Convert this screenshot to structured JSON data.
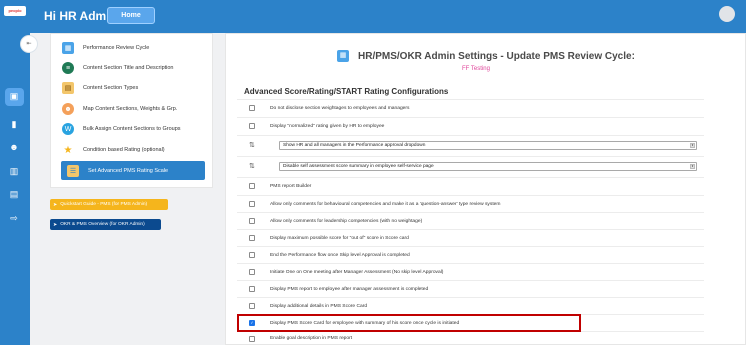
{
  "topbar": {
    "logo_text": "peoplo",
    "greeting": "Hi HR Admin",
    "home_label": "Home"
  },
  "rail": {
    "toggle_glyph": "⇤"
  },
  "menu": {
    "items": [
      {
        "label": "Performance Review Cycle",
        "icon": "calendar-icon"
      },
      {
        "label": "Content Section Title and Description",
        "icon": "section-icon"
      },
      {
        "label": "Content Section Types",
        "icon": "types-icon"
      },
      {
        "label": "Map Content Sections, Weights & Grp.",
        "icon": "map-user-icon"
      },
      {
        "label": "Bulk Assign Content Sections to Groups",
        "icon": "bulk-assign-icon"
      },
      {
        "label": "Condition based Rating (optional)",
        "icon": "star-icon"
      },
      {
        "label": "Set Advanced PMS Rating Scale",
        "icon": "rating-scale-icon"
      }
    ]
  },
  "guides": {
    "quickstart": "Quickstart Guide - PMS (for PMS Admin)",
    "overview": "OKR & PMS Overview (for OKR Admin)"
  },
  "main": {
    "title": "HR/PMS/OKR Admin Settings - Update PMS Review Cycle:",
    "subtitle": "FF Testing",
    "section_title": "Advanced Score/Rating/START Rating Configurations",
    "options": [
      {
        "label": "Do not disclose section weightages to employees and managers",
        "checked": false
      },
      {
        "label": "Display \"normalized\" rating given by HR to employee",
        "checked": false
      },
      {
        "select": "Show HR and all managers in the Performance approval dropdown"
      },
      {
        "select": "Disable self assessment score summary in employee self-service page"
      },
      {
        "label": "PMS report Builder",
        "checked": false
      },
      {
        "label": "Allow only comments for behavioural competencies and make it as a 'question-answer' type review system",
        "checked": false
      },
      {
        "label": "Allow only comments for leadership competencies (with no weightage)",
        "checked": false
      },
      {
        "label": "Display maximum possible score for \"out of\" score in Score card",
        "checked": false
      },
      {
        "label": "End the Performance flow once Skip level Approval is completed",
        "checked": false
      },
      {
        "label": "Initiate One on One meeting after Manager Assessment (No skip level Approval)",
        "checked": false
      },
      {
        "label": "Display PMS report to employee after manager assessment is completed",
        "checked": false
      },
      {
        "label": "Display additional details in PMS Score Card",
        "checked": false
      },
      {
        "label": "Display PMS Score Card for employee with summary of his score once cycle is initiated",
        "checked": true
      },
      {
        "label": "Enable goal description in PMS report",
        "checked": false
      }
    ]
  },
  "colors": {
    "primary": "#2c82c9",
    "accent": "#5aa6ec",
    "quickstart": "#f5b51c",
    "overview": "#0b4a8f",
    "highlight": "#c00000",
    "subtitle": "#e0469b"
  }
}
